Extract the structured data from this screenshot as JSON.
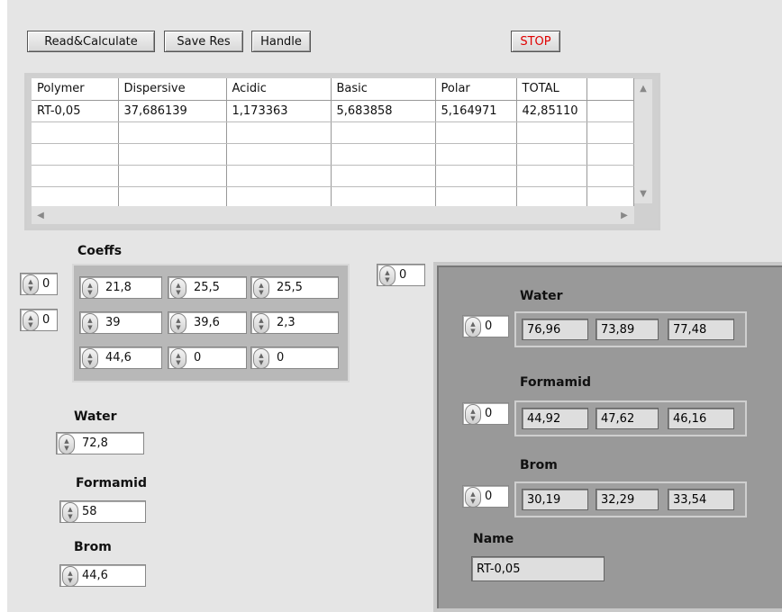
{
  "toolbar": {
    "read_label": "Read&Calculate",
    "save_label": "Save Res",
    "handle_label": "Handle",
    "stop_label": "STOP"
  },
  "table": {
    "headers": [
      "Polymer",
      "Dispersive",
      "Acidic",
      "Basic",
      "Polar",
      "TOTAL"
    ],
    "rows": [
      [
        "RT-0,05",
        "37,686139",
        "1,173363",
        "5,683858",
        "5,164971",
        "42,85110"
      ]
    ]
  },
  "coeffs": {
    "label": "Coeffs",
    "row_index": "0",
    "col_index": "0",
    "values": [
      [
        "21,8",
        "25,5",
        "25,5"
      ],
      [
        "39",
        "39,6",
        "2,3"
      ],
      [
        "44,6",
        "0",
        "0"
      ]
    ]
  },
  "inputs": {
    "water_label": "Water",
    "water_value": "72,8",
    "formamid_label": "Formamid",
    "formamid_value": "58",
    "brom_label": "Brom",
    "brom_value": "44,6"
  },
  "panel_index": "0",
  "results": {
    "water": {
      "label": "Water",
      "index": "0",
      "values": [
        "76,96",
        "73,89",
        "77,48"
      ]
    },
    "formamid": {
      "label": "Formamid",
      "index": "0",
      "values": [
        "44,92",
        "47,62",
        "46,16"
      ]
    },
    "brom": {
      "label": "Brom",
      "index": "0",
      "values": [
        "30,19",
        "32,29",
        "33,54"
      ]
    },
    "name_label": "Name",
    "name_value": "RT-0,05"
  }
}
